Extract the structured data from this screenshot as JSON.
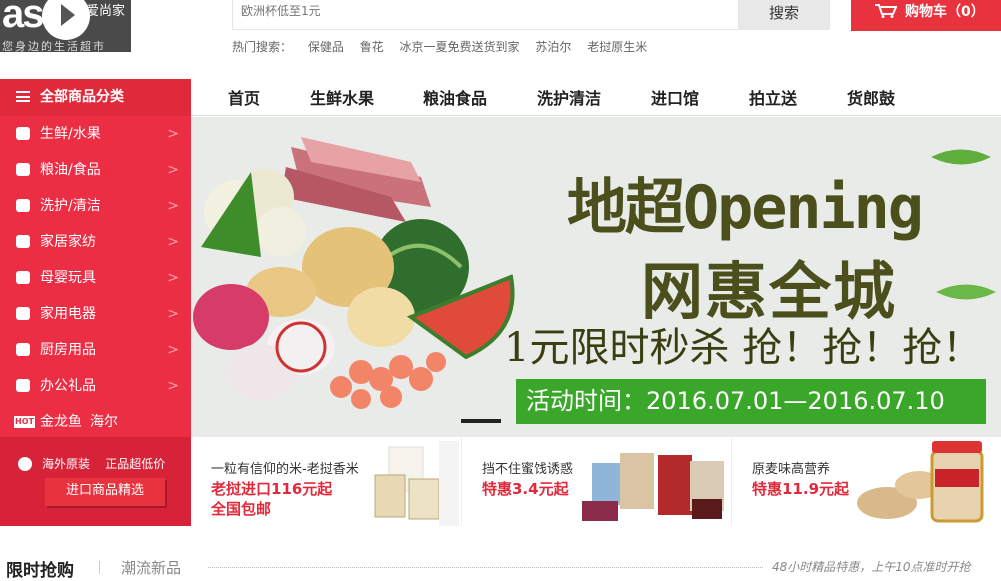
{
  "logo": {
    "text": "as",
    "name": "爱尚家",
    "slogan": "您身边的生活超市"
  },
  "search": {
    "placeholder": "欧洲杯低至1元",
    "button": "搜索"
  },
  "hot_search": {
    "label": "热门搜索：",
    "items": [
      "保健品",
      "鲁花",
      "冰京一夏免费送货到家",
      "苏泊尔",
      "老挝原生米"
    ]
  },
  "cart": {
    "label": "购物车（0）"
  },
  "category_header": "全部商品分类",
  "categories": [
    {
      "label": "生鲜/水果",
      "icon": "eye-icon"
    },
    {
      "label": "粮油/食品",
      "icon": "pot-icon"
    },
    {
      "label": "洗护/清洁",
      "icon": "drops-icon"
    },
    {
      "label": "家居家纺",
      "icon": "sofa-icon"
    },
    {
      "label": "母婴玩具",
      "icon": "baby-bottle-icon"
    },
    {
      "label": "家用电器",
      "icon": "tv-icon"
    },
    {
      "label": "厨房用品",
      "icon": "book-icon"
    },
    {
      "label": "办公礼品",
      "icon": "briefcase-icon"
    }
  ],
  "hot_brands": {
    "badge": "HOT",
    "brands": [
      "金龙鱼",
      "海尔"
    ]
  },
  "overseas": {
    "left": "海外原装",
    "right": "正品超低价",
    "button": "进口商品精选"
  },
  "nav": [
    "首页",
    "生鲜水果",
    "粮油食品",
    "洗护清洁",
    "进口馆",
    "拍立送",
    "货郎鼓"
  ],
  "banner": {
    "title": "地超Opening",
    "subtitle": "网惠全城",
    "promo": "1元限时秒杀 抢！抢！抢！",
    "time": "活动时间：2016.07.01—2016.07.10",
    "slides_count": 1
  },
  "promos": [
    {
      "line1": "一粒有信仰的米-老挝香米",
      "line2": "老挝进口116元起",
      "line3": "全国包邮"
    },
    {
      "line1": "挡不住蜜饯诱惑",
      "line2": "特惠3.4元起",
      "line3": ""
    },
    {
      "line1": "原麦味高营养",
      "line2": "特惠11.9元起",
      "line3": ""
    }
  ],
  "bottom": {
    "flash": "限时抢购",
    "trend": "潮流新品",
    "note": "48小时精品特惠，上午10点准时开抢"
  },
  "colors": {
    "accent": "#e02a3c",
    "menu_bg": "#ec2e45",
    "banner_green": "#3aa72b"
  }
}
